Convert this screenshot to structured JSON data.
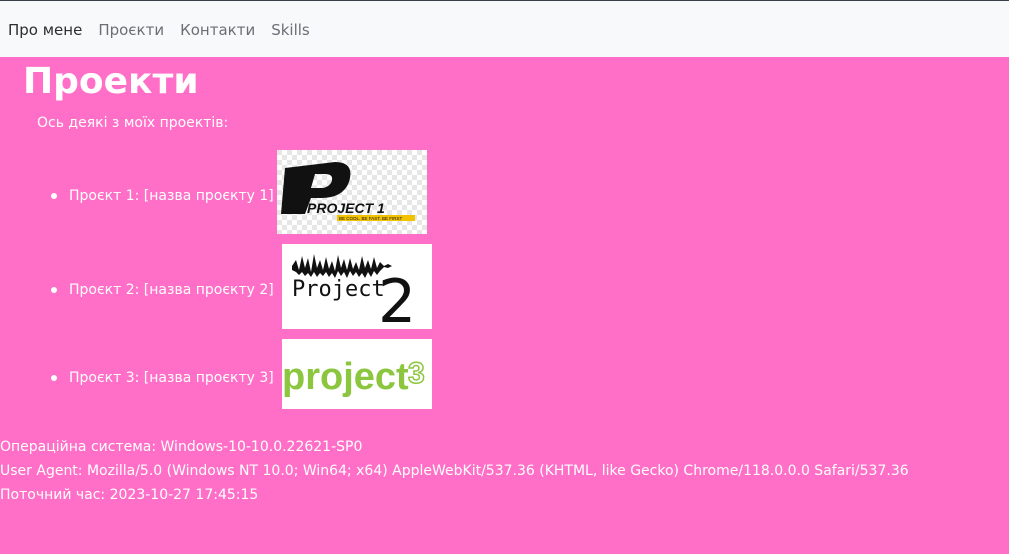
{
  "nav": {
    "items": [
      {
        "label": "Про мене"
      },
      {
        "label": "Проєкти"
      },
      {
        "label": "Контакти"
      },
      {
        "label": "Skills"
      }
    ]
  },
  "main": {
    "title": "Проекти",
    "intro": "Ось деякі з моїх проектів:",
    "projects": [
      {
        "label": "Проєкт 1: [назва проєкту 1]",
        "logo_text": "PROJECT 1",
        "logo_tagline": "BE COOL. BE FAST. BE FIRST"
      },
      {
        "label": "Проєкт 2: [назва проєкту 2]",
        "logo_text": "Project",
        "logo_number": "2"
      },
      {
        "label": "Проєкт 3: [назва проєкту 3]",
        "logo_text": "project",
        "logo_number": "3"
      }
    ]
  },
  "info": {
    "os": "Операційна система: Windows-10-10.0.22621-SP0",
    "user_agent": "User Agent: Mozilla/5.0 (Windows NT 10.0; Win64; x64) AppleWebKit/537.36 (KHTML, like Gecko) Chrome/118.0.0.0 Safari/537.36",
    "time": "Поточний час: 2023-10-27 17:45:15"
  },
  "colors": {
    "page_background": "#ff6ec7",
    "navbar_background": "#f8f9fa",
    "text": "#ffffff",
    "project3_green": "#8cc63f"
  }
}
